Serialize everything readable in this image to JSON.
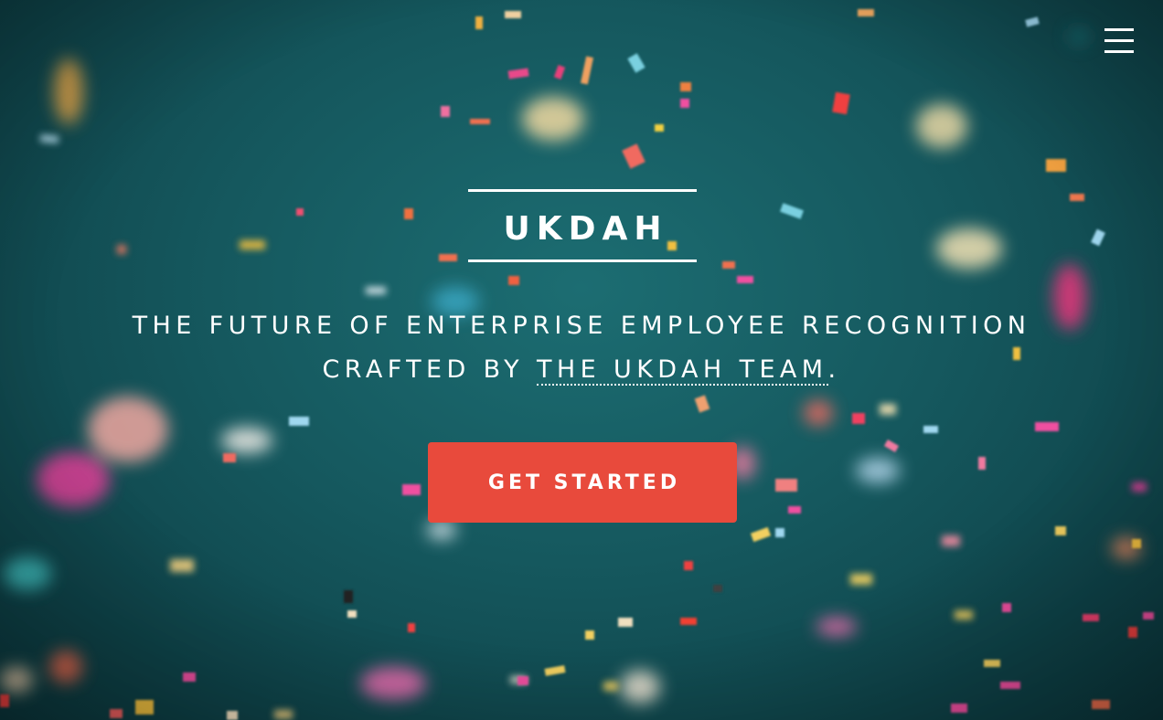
{
  "header": {
    "menu_icon": "hamburger-menu-icon"
  },
  "hero": {
    "title": "UKDAH",
    "tagline_line1": "THE FUTURE OF ENTERPRISE EMPLOYEE RECOGNITION",
    "tagline_prefix": "CRAFTED BY ",
    "tagline_link": "THE UKDAH TEAM",
    "tagline_suffix": ".",
    "cta_label": "GET STARTED"
  },
  "colors": {
    "background": "#15585e",
    "accent": "#e84a3c",
    "text": "#ffffff"
  }
}
